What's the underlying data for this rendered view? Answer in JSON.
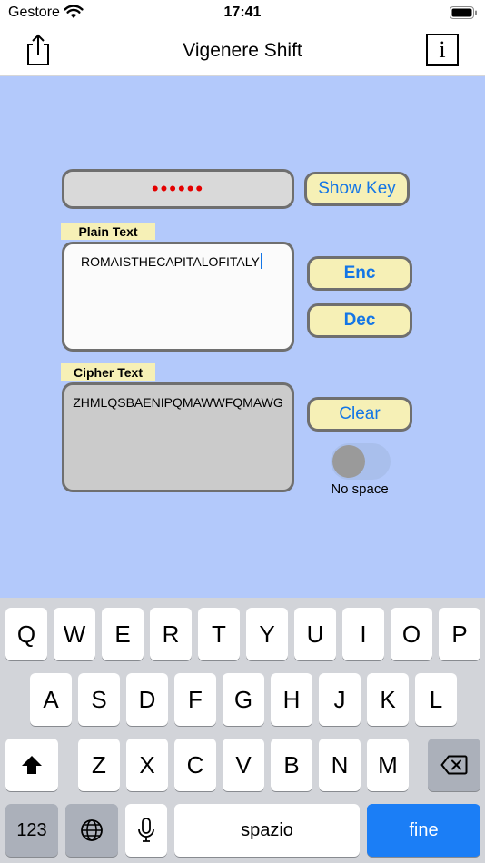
{
  "status_bar": {
    "carrier": "Gestore",
    "time": "17:41"
  },
  "nav": {
    "title": "Vigenere Shift",
    "info_label": "i"
  },
  "key_field": {
    "value": "••••••",
    "show_key_label": "Show Key"
  },
  "plain": {
    "label": "Plain Text",
    "value": "ROMAISTHECAPITALOFITALY"
  },
  "buttons": {
    "enc": "Enc",
    "dec": "Dec",
    "clear": "Clear"
  },
  "cipher": {
    "label": "Cipher Text",
    "value": "ZHMLQSBAENIPQMAWWFQMAWG"
  },
  "toggle": {
    "label": "No space",
    "on": false
  },
  "keyboard": {
    "row1": [
      "Q",
      "W",
      "E",
      "R",
      "T",
      "Y",
      "U",
      "I",
      "O",
      "P"
    ],
    "row2": [
      "A",
      "S",
      "D",
      "F",
      "G",
      "H",
      "J",
      "K",
      "L"
    ],
    "row3": [
      "Z",
      "X",
      "C",
      "V",
      "B",
      "N",
      "M"
    ],
    "numbers_label": "123",
    "space_label": "spazio",
    "done_label": "fine"
  },
  "colors": {
    "background": "#b3c9fb",
    "button_fill": "#f6f0b6",
    "button_text": "#1476e6",
    "key_dots": "#e40000",
    "keyboard_bg": "#d2d4d9",
    "done_key": "#1b7ef6"
  },
  "icons": {
    "share": "share-icon",
    "info": "info-icon",
    "wifi": "wifi-icon",
    "battery": "battery-icon",
    "shift": "shift-icon",
    "delete": "delete-icon",
    "globe": "globe-icon",
    "mic": "microphone-icon"
  }
}
